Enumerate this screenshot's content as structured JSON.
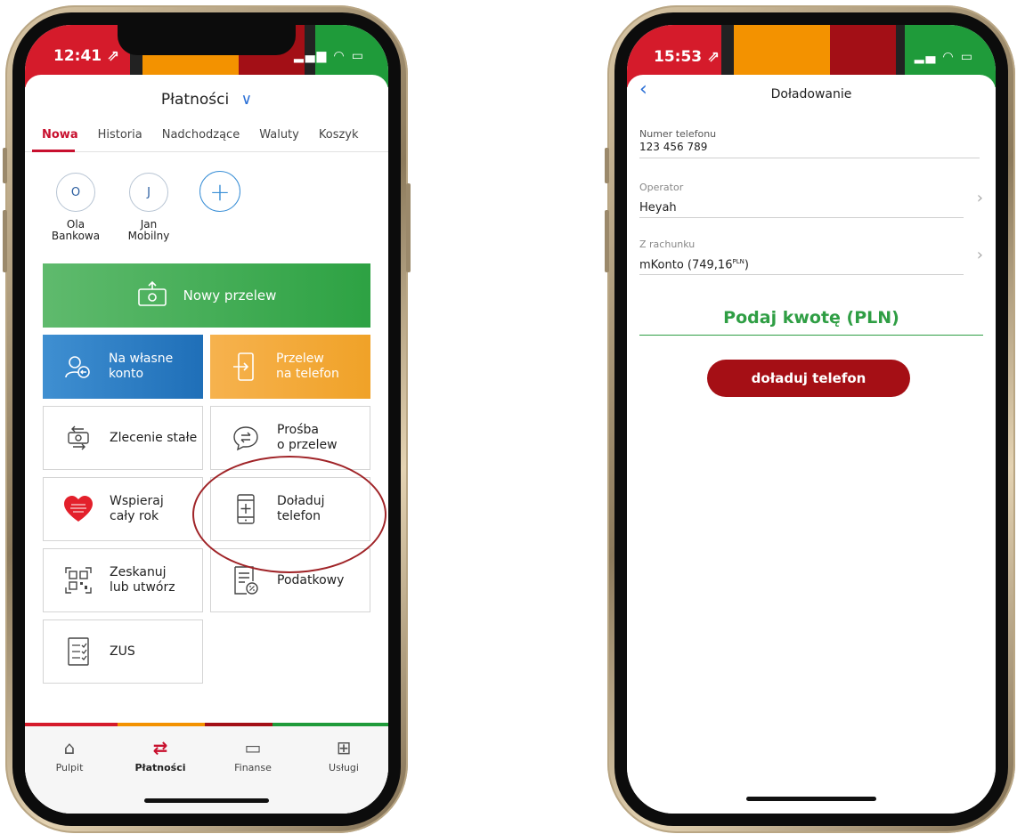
{
  "left": {
    "status": {
      "time": "12:41 ⇗",
      "icons": "▂▄▆ ◠ ▭"
    },
    "header": {
      "title": "Płatności",
      "chevron": "∨"
    },
    "tabs": [
      {
        "label": "Nowa"
      },
      {
        "label": "Historia"
      },
      {
        "label": "Nadchodzące"
      },
      {
        "label": "Waluty"
      },
      {
        "label": "Koszyk"
      }
    ],
    "contacts": [
      {
        "initial": "O",
        "line1": "Ola",
        "line2": "Bankowa"
      },
      {
        "initial": "J",
        "line1": "Jan",
        "line2": "Mobilny"
      }
    ],
    "add_contact": "+",
    "tiles": {
      "nowy_przelew": "Nowy przelew",
      "na_wlasne_1": "Na własne",
      "na_wlasne_2": "konto",
      "przelew_tel_1": "Przelew",
      "przelew_tel_2": "na telefon",
      "zlecenie": "Zlecenie stałe",
      "prosba_1": "Prośba",
      "prosba_2": "o przelew",
      "wspieraj_1": "Wspieraj",
      "wspieraj_2": "cały rok",
      "doladuj_1": "Doładuj",
      "doladuj_2": "telefon",
      "zeskanuj_1": "Zeskanuj",
      "zeskanuj_2": "lub utwórz",
      "podatkowy": "Podatkowy",
      "zus": "ZUS"
    },
    "tabbar": [
      {
        "label": "Pulpit",
        "icon": "home-icon"
      },
      {
        "label": "Płatności",
        "icon": "transfer-icon"
      },
      {
        "label": "Finanse",
        "icon": "wallet-icon"
      },
      {
        "label": "Usługi",
        "icon": "grid-icon"
      }
    ]
  },
  "right": {
    "status": {
      "time": "15:53 ⇗",
      "icons": "▂▄ ◠ ▭"
    },
    "header": {
      "title": "Doładowanie",
      "back": "‹"
    },
    "fields": {
      "phone_label": "Numer telefonu",
      "phone_value": "123 456 789",
      "operator_label": "Operator",
      "operator_value": "Heyah",
      "account_label": "Z rachunku",
      "account_value": "mKonto (749,16",
      "account_currency": "PLN",
      "account_close": ")"
    },
    "amount_placeholder": "Podaj kwotę (PLN)",
    "cta": "doładuj telefon"
  },
  "colors": {
    "accent_red": "#c8102e",
    "green": "#2f9e44",
    "cta": "#a50f15",
    "blue": "#1f6fb8",
    "orange": "#f0a228"
  }
}
